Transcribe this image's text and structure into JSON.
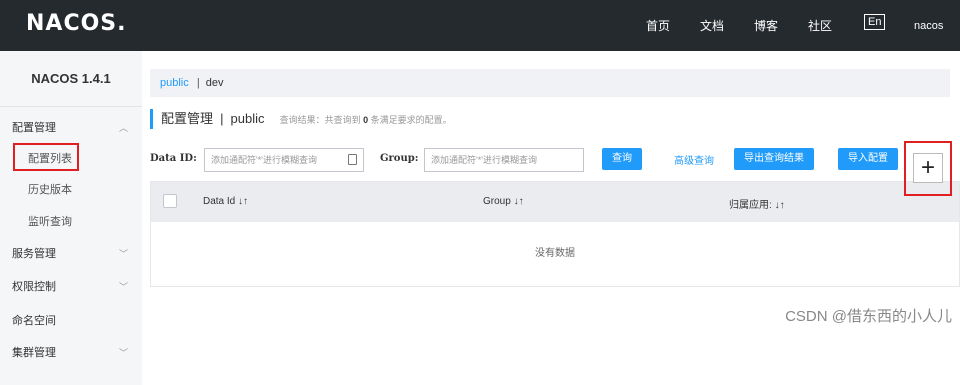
{
  "topbar": {
    "logo": "NACOS.",
    "nav": [
      "首页",
      "文档",
      "博客",
      "社区"
    ],
    "lang": "En",
    "user": "nacos"
  },
  "sidebar": {
    "title": "NACOS 1.4.1",
    "items": [
      {
        "label": "配置管理",
        "type": "group",
        "expanded": true
      },
      {
        "label": "配置列表",
        "type": "sub",
        "active": true
      },
      {
        "label": "历史版本",
        "type": "sub"
      },
      {
        "label": "监听查询",
        "type": "sub"
      },
      {
        "label": "服务管理",
        "type": "group"
      },
      {
        "label": "权限控制",
        "type": "group"
      },
      {
        "label": "命名空间",
        "type": "item"
      },
      {
        "label": "集群管理",
        "type": "group"
      }
    ]
  },
  "namespace": {
    "items": [
      "public",
      "dev"
    ],
    "separator": "|"
  },
  "page": {
    "title": "配置管理",
    "separator": "|",
    "namespace": "public",
    "hint_prefix": "查询结果：共查询到",
    "hint_count": "0",
    "hint_suffix": "条满足要求的配置。"
  },
  "search": {
    "dataid_label": "Data ID:",
    "dataid_placeholder": "添加通配符'*'进行模糊查询",
    "group_label": "Group:",
    "group_placeholder": "添加通配符'*'进行模糊查询",
    "query_button": "查询",
    "advanced_link": "高级查询",
    "export_button": "导出查询结果",
    "import_button": "导入配置",
    "add_button": "+"
  },
  "table": {
    "columns": [
      "Data Id",
      "Group",
      "归属应用:"
    ],
    "sort_glyph": "↓↑",
    "empty_text": "没有数据"
  },
  "watermark": "CSDN @借东西的小人儿",
  "colors": {
    "topbar": "#252a2f",
    "accent": "#209bfa",
    "highlight": "#e02020"
  }
}
